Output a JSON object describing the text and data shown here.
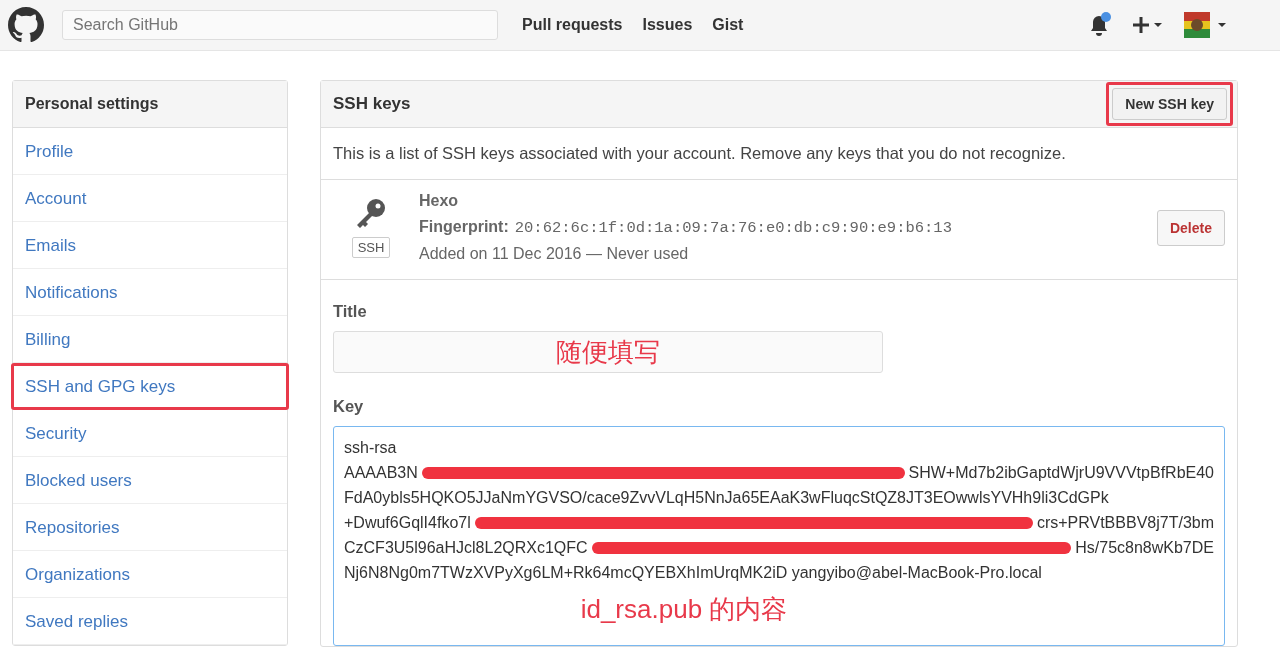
{
  "header": {
    "search": {
      "placeholder": "Search GitHub"
    },
    "nav": [
      "Pull requests",
      "Issues",
      "Gist"
    ],
    "notifications": {
      "unread": true
    }
  },
  "sidebar": {
    "title": "Personal settings",
    "items": [
      {
        "label": "Profile",
        "highlighted": false
      },
      {
        "label": "Account",
        "highlighted": false
      },
      {
        "label": "Emails",
        "highlighted": false
      },
      {
        "label": "Notifications",
        "highlighted": false
      },
      {
        "label": "Billing",
        "highlighted": false
      },
      {
        "label": "SSH and GPG keys",
        "highlighted": true
      },
      {
        "label": "Security",
        "highlighted": false
      },
      {
        "label": "Blocked users",
        "highlighted": false
      },
      {
        "label": "Repositories",
        "highlighted": false
      },
      {
        "label": "Organizations",
        "highlighted": false
      },
      {
        "label": "Saved replies",
        "highlighted": false
      }
    ]
  },
  "ssh_keys": {
    "title": "SSH keys",
    "new_button": {
      "label": "New SSH key",
      "highlighted": true
    },
    "description": "This is a list of SSH keys associated with your account. Remove any keys that you do not recognize.",
    "keys": [
      {
        "name": "Hexo",
        "badge": "SSH",
        "fingerprint_label": "Fingerprint:",
        "fingerprint": "20:62:6c:1f:0d:1a:09:7a:76:e0:db:c9:90:e9:b6:13",
        "added": "Added on 11 Dec 2016 — Never used",
        "delete_label": "Delete"
      }
    ]
  },
  "form": {
    "title_label": "Title",
    "title_note": "随便填写",
    "key_label": "Key",
    "key_note": "id_rsa.pub 的内容",
    "key_lines": [
      {
        "parts": [
          "ssh-rsa"
        ]
      },
      {
        "parts": [
          "AAAAB3N",
          "SHW+Md7b2ibGaptdWjrU9VVVtpBfRbE40"
        ]
      },
      {
        "parts": [
          "FdA0ybls5HQKO5JJaNmYGVSO/cace9ZvvVLqH5NnJa65EAaK3wFluqcStQZ8JT3EOwwlsYVHh9li3CdGPk"
        ]
      },
      {
        "parts": [
          "+Dwuf6GqlI4fko7l",
          "crs+PRVtBBBV8j7T/3bm"
        ]
      },
      {
        "parts": [
          "CzCF3U5l96aHJcl8L2QRXc1QFC",
          "Hs/75c8n8wKb7DE"
        ]
      },
      {
        "parts": [
          "Nj6N8Ng0m7TWzXVPyXg6LM+Rk64mcQYEBXhImUrqMK2iD yangyibo@abel-MacBook-Pro.local"
        ]
      }
    ]
  }
}
